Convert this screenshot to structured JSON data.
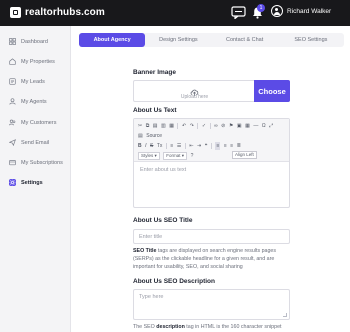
{
  "header": {
    "brand": "realtorhubs.com",
    "notification_count": "1",
    "user_name": "Richard Walker"
  },
  "sidebar": {
    "items": [
      {
        "label": "Dashboard",
        "icon": "dashboard-icon"
      },
      {
        "label": "My Properties",
        "icon": "home-icon"
      },
      {
        "label": "My Leads",
        "icon": "leads-icon"
      },
      {
        "label": "My Agents",
        "icon": "agent-icon"
      },
      {
        "label": "My Customers",
        "icon": "customers-icon"
      },
      {
        "label": "Send Email",
        "icon": "send-icon"
      },
      {
        "label": "My Subscriptions",
        "icon": "subscription-icon"
      },
      {
        "label": "Settings",
        "icon": "settings-icon",
        "active": true
      }
    ]
  },
  "tabs": [
    {
      "label": "About Agency",
      "active": true
    },
    {
      "label": "Design Settings"
    },
    {
      "label": "Contact & Chat"
    },
    {
      "label": "SEO Settings"
    }
  ],
  "form": {
    "banner_label": "Banner Image",
    "upload_text": "Upload here",
    "choose_label": "Choose",
    "about_label": "About Us Text",
    "editor": {
      "source_label": "Source",
      "styles_label": "Styles",
      "format_label": "Format",
      "tooltip": "Align Left",
      "placeholder": "Enter about us text"
    },
    "seo_title_label": "About Us SEO Title",
    "seo_title_placeholder": "Enter title",
    "seo_title_help_bold": "SEO Title",
    "seo_title_help": " tags are displayed on search engine results pages (SERPs) as the clickable headline for a given result, and are important for usability, SEO, and social sharing",
    "seo_desc_label": "About Us SEO Description",
    "seo_desc_placeholder": "Type here",
    "seo_desc_help_pre": "The SEO ",
    "seo_desc_help_bold": "description",
    "seo_desc_help": " tag in HTML is the 160 character snippet"
  },
  "colors": {
    "accent": "#5b4be6",
    "topbar": "#18181b",
    "sidebar_bg": "#f4f4f6"
  }
}
